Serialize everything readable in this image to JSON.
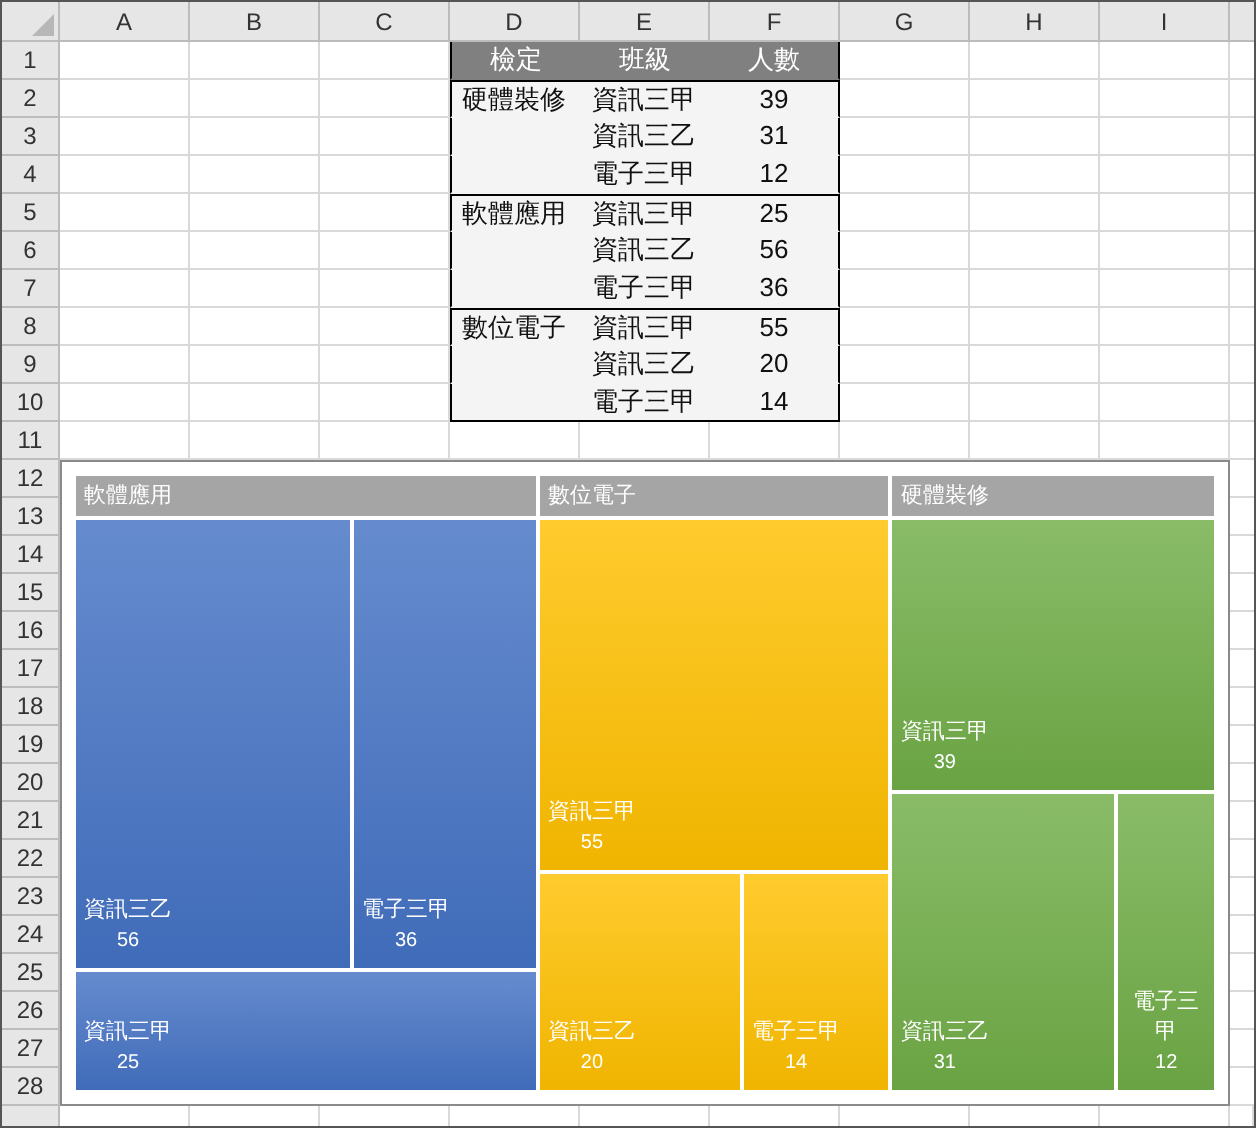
{
  "sheet": {
    "columns": [
      "A",
      "B",
      "C",
      "D",
      "E",
      "F",
      "G",
      "H",
      "I"
    ],
    "rows": [
      "1",
      "2",
      "3",
      "4",
      "5",
      "6",
      "7",
      "8",
      "9",
      "10",
      "11",
      "12",
      "13",
      "14",
      "15",
      "16",
      "17",
      "18",
      "19",
      "20",
      "21",
      "22",
      "23",
      "24",
      "25",
      "26",
      "27",
      "28"
    ]
  },
  "table": {
    "columns": [
      "檢定",
      "班級",
      "人數"
    ],
    "groups": [
      {
        "category": "硬體裝修",
        "rows": [
          {
            "class": "資訊三甲",
            "count": "39"
          },
          {
            "class": "資訊三乙",
            "count": "31"
          },
          {
            "class": "電子三甲",
            "count": "12"
          }
        ]
      },
      {
        "category": "軟體應用",
        "rows": [
          {
            "class": "資訊三甲",
            "count": "25"
          },
          {
            "class": "資訊三乙",
            "count": "56"
          },
          {
            "class": "電子三甲",
            "count": "36"
          }
        ]
      },
      {
        "category": "數位電子",
        "rows": [
          {
            "class": "資訊三甲",
            "count": "55"
          },
          {
            "class": "資訊三乙",
            "count": "20"
          },
          {
            "class": "電子三甲",
            "count": "14"
          }
        ]
      }
    ]
  },
  "treemap": {
    "groups": [
      {
        "name": "軟體應用",
        "color": "#4472c4",
        "tiles": [
          {
            "label": "資訊三乙",
            "value": "56"
          },
          {
            "label": "電子三甲",
            "value": "36"
          },
          {
            "label": "資訊三甲",
            "value": "25"
          }
        ]
      },
      {
        "name": "數位電子",
        "color": "#ffc000",
        "tiles": [
          {
            "label": "資訊三甲",
            "value": "55"
          },
          {
            "label": "資訊三乙",
            "value": "20"
          },
          {
            "label": "電子三甲",
            "value": "14"
          }
        ]
      },
      {
        "name": "硬體裝修",
        "color": "#70ad47",
        "tiles": [
          {
            "label": "資訊三甲",
            "value": "39"
          },
          {
            "label": "資訊三乙",
            "value": "31"
          },
          {
            "label": "電子三甲",
            "value": "12"
          }
        ]
      }
    ]
  }
}
